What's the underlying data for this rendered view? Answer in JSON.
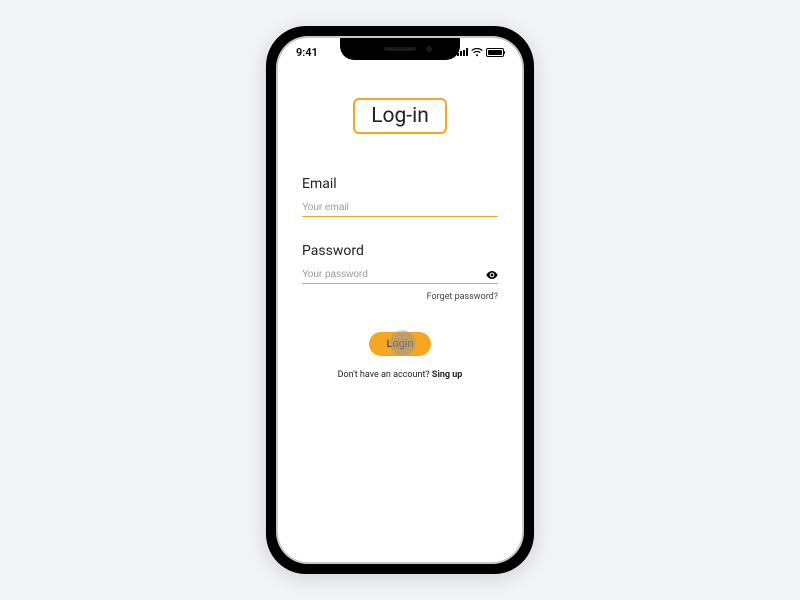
{
  "status": {
    "time": "9:41"
  },
  "title": "Log-in",
  "form": {
    "email": {
      "label": "Email",
      "placeholder": "Your email"
    },
    "password": {
      "label": "Password",
      "placeholder": "Your password"
    },
    "forgot": "Forget password?",
    "login_label": "Login",
    "signup_prompt": "Don't have an account? ",
    "signup_link": "Sing up"
  },
  "colors": {
    "accent": "#f5a623"
  }
}
